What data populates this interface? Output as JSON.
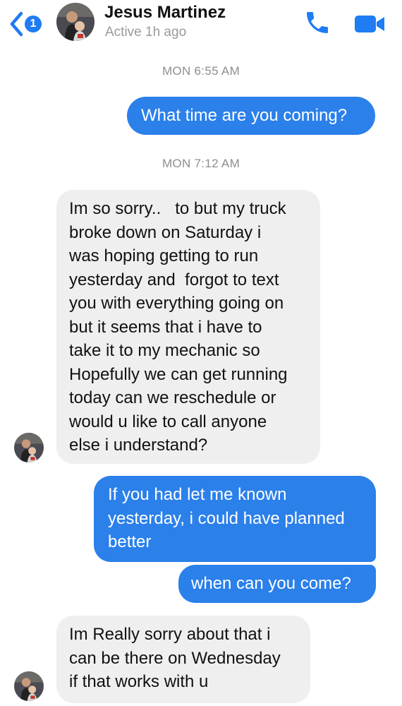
{
  "header": {
    "back_badge_count": "1",
    "contact_name": "Jesus Martinez",
    "status": "Active 1h ago",
    "accent_color": "#1f7cf2"
  },
  "icons": {
    "back": "chevron-left-icon",
    "call": "phone-icon",
    "video": "video-camera-icon"
  },
  "conversation": {
    "timestamps": [
      "MON 6:55 AM",
      "MON 7:12 AM"
    ],
    "messages": [
      {
        "direction": "outgoing",
        "text": "What time are you coming?"
      },
      {
        "direction": "incoming",
        "text": "Im so sorry..   to but my truck\nbroke down on Saturday i\nwas hoping getting to run\nyesterday and  forgot to text\nyou with everything going on\nbut it seems that i have to\ntake it to my mechanic so\nHopefully we can get running\ntoday can we reschedule or\nwould u like to call anyone\nelse i understand?"
      },
      {
        "direction": "outgoing",
        "text": "If you had let me known yesterday, i could have planned better"
      },
      {
        "direction": "outgoing",
        "text": "when can you come?"
      },
      {
        "direction": "incoming",
        "text": "Im Really sorry about that i\ncan be there on Wednesday\nif that works with u"
      }
    ],
    "colors": {
      "outgoing_bubble": "#2b80ea",
      "incoming_bubble": "#efefef",
      "timestamp_text": "#8e8e8e"
    }
  }
}
